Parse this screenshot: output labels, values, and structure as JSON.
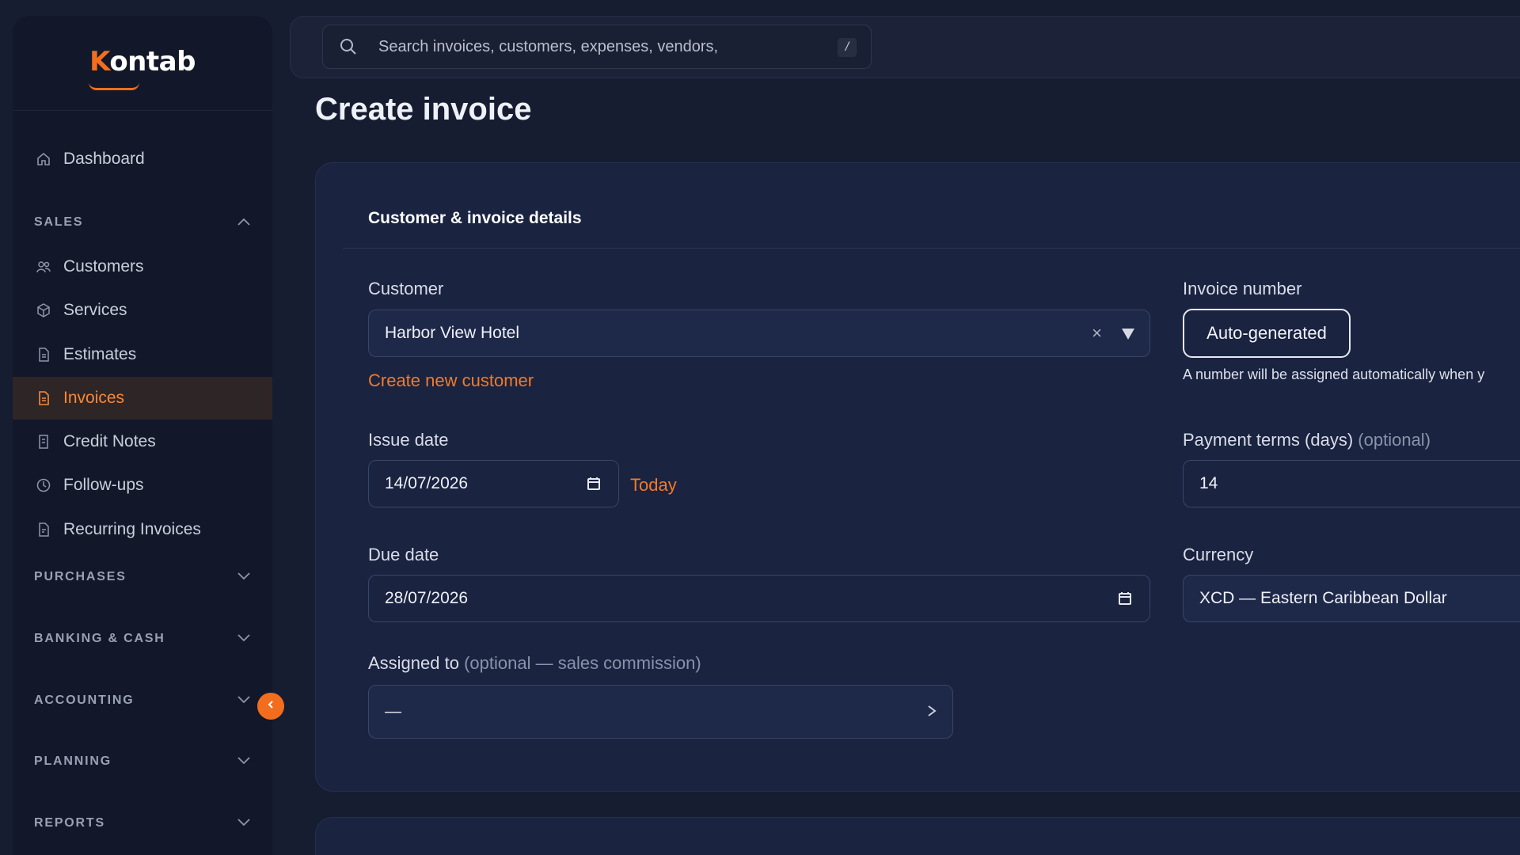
{
  "brand": {
    "logo_k": "K",
    "logo_rest": "ontab"
  },
  "search": {
    "placeholder": "Search invoices, customers, expenses, vendors,",
    "shortcut": "/"
  },
  "page": {
    "title": "Create invoice"
  },
  "sidebar": {
    "dashboard": "Dashboard",
    "sales_heading": "SALES",
    "sales_items": [
      {
        "label": "Customers",
        "icon": "customers-icon"
      },
      {
        "label": "Services",
        "icon": "cube-icon"
      },
      {
        "label": "Estimates",
        "icon": "document-icon"
      },
      {
        "label": "Invoices",
        "icon": "invoice-icon",
        "active": true
      },
      {
        "label": "Credit Notes",
        "icon": "credit-note-icon"
      },
      {
        "label": "Follow-ups",
        "icon": "clock-icon"
      },
      {
        "label": "Recurring Invoices",
        "icon": "recurring-icon"
      }
    ],
    "sections": [
      "PURCHASES",
      "BANKING & CASH",
      "ACCOUNTING",
      "PLANNING",
      "REPORTS"
    ]
  },
  "form": {
    "section_title": "Customer & invoice details",
    "customer_label": "Customer",
    "customer_value": "Harbor View Hotel",
    "create_customer_link": "Create new customer",
    "invoice_number_label": "Invoice number",
    "invoice_number_value": "Auto-generated",
    "invoice_number_hint": "A number will be assigned automatically when y",
    "issue_date_label": "Issue date",
    "issue_date_value": "14/07/2026",
    "today_link": "Today",
    "payment_terms_label": "Payment terms (days)",
    "payment_terms_optional": "(optional)",
    "payment_terms_value": "14",
    "due_date_label": "Due date",
    "due_date_value": "28/07/2026",
    "currency_label": "Currency",
    "currency_value": "XCD — Eastern Caribbean Dollar",
    "assigned_label": "Assigned to",
    "assigned_optional": "(optional — sales commission)",
    "assigned_value": "—",
    "clear_symbol": "×"
  },
  "colors": {
    "accent": "#f26e1e",
    "bg": "#171d31",
    "card": "#1a2340",
    "sidebar": "#121829"
  }
}
